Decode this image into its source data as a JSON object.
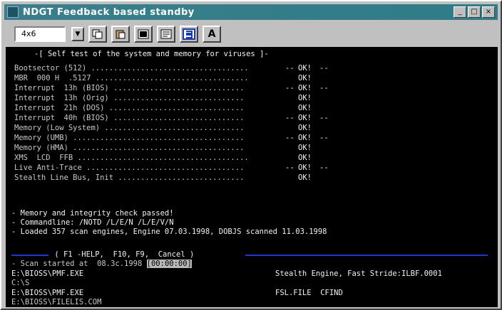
{
  "window": {
    "title": "NDGT Feedback based standby",
    "buttons": [
      "_",
      "□",
      "×"
    ]
  },
  "toolbar": {
    "font_size": "4x6",
    "tools": [
      "copy-icon",
      "paste-icon",
      "fullscreen-icon",
      "properties-icon",
      "background-icon",
      "A"
    ]
  },
  "console": {
    "header": "-[ Self test of the system and memory for viruses ]-",
    "checks": [
      {
        "label": "Bootsector (512) ...................................",
        "status": "OK!",
        "dash": true
      },
      {
        "label": "MBR  000 H  .5127 ..................................",
        "status": "OK!",
        "dash": false
      },
      {
        "label": "Interrupt  13h (BIOS) .............................",
        "status": "OK!",
        "dash": true
      },
      {
        "label": "Interrupt  13h (Orig) .............................",
        "status": "OK!",
        "dash": false
      },
      {
        "label": "Interrupt  21h (DOS) ..............................",
        "status": "OK!",
        "dash": false
      },
      {
        "label": "Interrupt  40h (BIOS) .............................",
        "status": "OK!",
        "dash": true
      },
      {
        "label": "Memory (Low System) ...............................",
        "status": "OK!",
        "dash": false
      },
      {
        "label": "Memory (UMB) ......................................",
        "status": "OK!",
        "dash": true
      },
      {
        "label": "Memory (HMA) ......................................",
        "status": "OK!",
        "dash": false
      },
      {
        "label": "XMS  LCD  FFB ......................................",
        "status": "OK!",
        "dash": false
      },
      {
        "label": "Live Anti-Trace ...................................",
        "status": "OK!",
        "dash": true
      },
      {
        "label": "Stealth Line Bus, Init ............................",
        "status": "OK!",
        "dash": false
      }
    ],
    "messages": [
      "- Memory and integrity check passed!",
      "- Commandline: /NOTD /L/E/N /L/E/V/N",
      "- Loaded 357 scan engines, Engine 07.03.1998, DOBJS scanned 11.03.1998"
    ],
    "menu": " ( F1 -HELP,  F10, F9,  Cancel ) ",
    "status_prefix": "- Scan started at  08.3c.1998 ",
    "status_time": "[00:00:00]",
    "files": [
      {
        "path": "E:\\BIOSS\\PMF.EXE",
        "info": "Stealth Engine, Fast Stride:ILBF.0001"
      },
      {
        "path": "C:\\S",
        "info": ""
      },
      {
        "path": "E:\\BIOSS\\PMF.EXE",
        "info": "FSL.FILE  CFIND"
      },
      {
        "path": "E:\\BIOSS\\FILELIS.COM",
        "info": ""
      }
    ]
  }
}
